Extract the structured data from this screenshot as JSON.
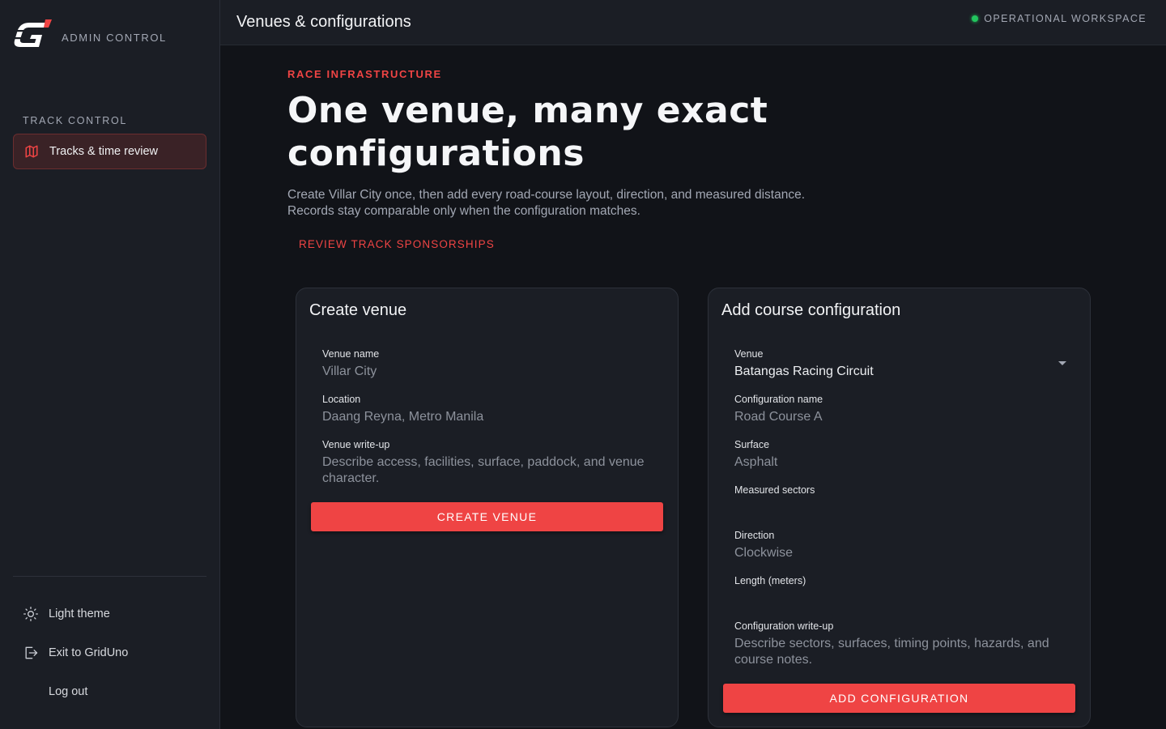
{
  "brand": {
    "subtitle": "ADMIN CONTROL",
    "accent": "#ef4444"
  },
  "sidebar": {
    "section_label": "TRACK CONTROL",
    "items": [
      {
        "label": "Tracks & time review",
        "icon": "map-icon",
        "active": true
      }
    ],
    "actions": [
      {
        "label": "Light theme",
        "icon": "sun-icon"
      },
      {
        "label": "Exit to GridUno",
        "icon": "exit-icon"
      },
      {
        "label": "Log out"
      }
    ]
  },
  "topbar": {
    "title": "Venues & configurations",
    "status": "OPERATIONAL WORKSPACE",
    "status_color": "#22c55e"
  },
  "main": {
    "eyebrow": "RACE INFRASTRUCTURE",
    "headline": "One venue, many exact configurations",
    "description_line1": "Create Villar City once, then add every road-course layout, direction, and measured distance.",
    "description_line2": "Records stay comparable only when the configuration matches.",
    "sponsorship_link": "REVIEW TRACK SPONSORSHIPS"
  },
  "create_venue": {
    "title": "Create venue",
    "fields": [
      {
        "label": "Venue name",
        "placeholder": "Villar City"
      },
      {
        "label": "Location",
        "placeholder": "Daang Reyna, Metro Manila"
      },
      {
        "label": "Venue write-up",
        "placeholder": "Describe access, facilities, surface, paddock, and venue character."
      }
    ],
    "submit": "CREATE VENUE"
  },
  "add_configuration": {
    "title": "Add course configuration",
    "fields": [
      {
        "label": "Venue",
        "value": "Batangas Racing Circuit"
      },
      {
        "label": "Configuration name",
        "placeholder": "Road Course A"
      },
      {
        "label": "Surface",
        "placeholder": "Asphalt"
      },
      {
        "label": "Measured sectors",
        "placeholder": ""
      },
      {
        "label": "Direction",
        "placeholder": "Clockwise"
      },
      {
        "label": "Length (meters)",
        "placeholder": ""
      },
      {
        "label": "Configuration write-up",
        "placeholder": "Describe sectors, surfaces, timing points, hazards, and course notes."
      }
    ],
    "submit": "ADD CONFIGURATION"
  }
}
